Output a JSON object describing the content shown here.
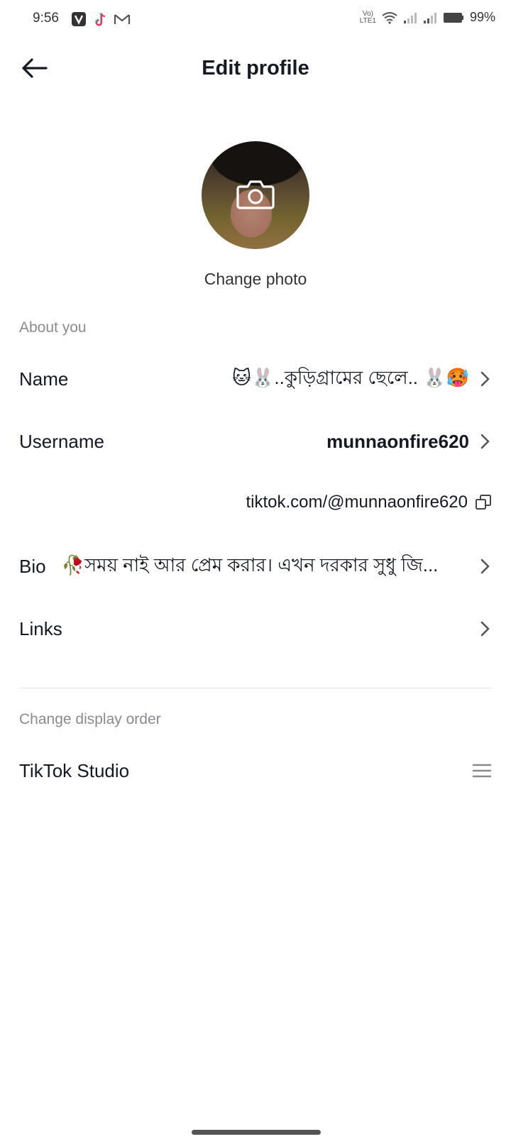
{
  "status_bar": {
    "time": "9:56",
    "battery": "99%",
    "apps": [
      "vivo-icon",
      "tiktok-icon",
      "gmail-icon"
    ]
  },
  "header": {
    "title": "Edit profile",
    "back_icon": "back-arrow-icon"
  },
  "profile_photo": {
    "change_label": "Change photo",
    "icon": "camera-icon"
  },
  "about": {
    "section_label": "About you",
    "name_label": "Name",
    "name_value": "🐱🐰..কুড়িগ্রামের ছেলে.. 🐰🥵",
    "username_label": "Username",
    "username_value": "munnaonfire620",
    "profile_link": "tiktok.com/@munnaonfire620",
    "bio_label": "Bio",
    "bio_value": "🥀সময় নাই আর প্রেম করার। এখন দরকার সুধু জি...",
    "links_label": "Links"
  },
  "display_order": {
    "section_label": "Change display order",
    "item_label": "TikTok Studio"
  },
  "colors": {
    "text_primary": "#161823",
    "text_secondary": "#8a8b91",
    "divider": "#e3e3e4"
  }
}
